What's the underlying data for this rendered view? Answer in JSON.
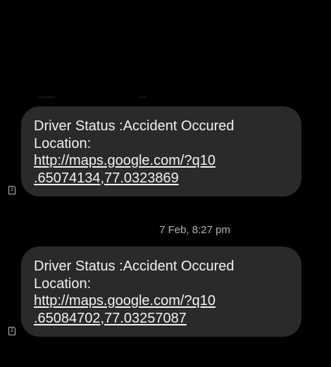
{
  "conversation": {
    "messages": [
      {
        "lines": [
          "Driver Status :Accident Occured",
          "Location:"
        ],
        "link": [
          "http://maps.google.com/?q10",
          ".65074134,77.0323869"
        ],
        "sim_label": "2"
      },
      {
        "lines": [
          "Driver Status :Accident Occured",
          "Location:"
        ],
        "link": [
          "http://maps.google.com/?q10",
          ".65084702,77.03257087"
        ],
        "sim_label": "2"
      }
    ],
    "timestamp": "7 Feb, 8:27 pm"
  },
  "colors": {
    "background": "#000000",
    "bubble": "#2a2a2a",
    "text": "#f2f2f2",
    "timestamp": "#b3b3b3"
  },
  "icons": [
    "sim-card-icon"
  ]
}
